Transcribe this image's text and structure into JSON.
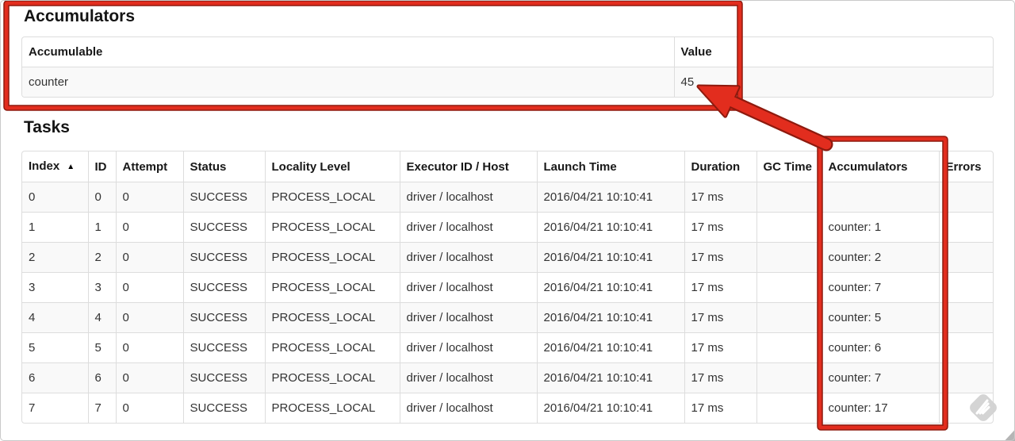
{
  "accumulators_section": {
    "heading": "Accumulators",
    "table": {
      "headers": [
        "Accumulable",
        "Value"
      ],
      "row": [
        "counter",
        "45"
      ]
    }
  },
  "tasks_section": {
    "heading": "Tasks",
    "sort_arrow": "▲",
    "table": {
      "headers": [
        "Index",
        "ID",
        "Attempt",
        "Status",
        "Locality Level",
        "Executor ID / Host",
        "Launch Time",
        "Duration",
        "GC Time",
        "Accumulators",
        "Errors"
      ],
      "rows": [
        [
          "0",
          "0",
          "0",
          "SUCCESS",
          "PROCESS_LOCAL",
          "driver / localhost",
          "2016/04/21 10:10:41",
          "17 ms",
          "",
          "",
          ""
        ],
        [
          "1",
          "1",
          "0",
          "SUCCESS",
          "PROCESS_LOCAL",
          "driver / localhost",
          "2016/04/21 10:10:41",
          "17 ms",
          "",
          "counter: 1",
          ""
        ],
        [
          "2",
          "2",
          "0",
          "SUCCESS",
          "PROCESS_LOCAL",
          "driver / localhost",
          "2016/04/21 10:10:41",
          "17 ms",
          "",
          "counter: 2",
          ""
        ],
        [
          "3",
          "3",
          "0",
          "SUCCESS",
          "PROCESS_LOCAL",
          "driver / localhost",
          "2016/04/21 10:10:41",
          "17 ms",
          "",
          "counter: 7",
          ""
        ],
        [
          "4",
          "4",
          "0",
          "SUCCESS",
          "PROCESS_LOCAL",
          "driver / localhost",
          "2016/04/21 10:10:41",
          "17 ms",
          "",
          "counter: 5",
          ""
        ],
        [
          "5",
          "5",
          "0",
          "SUCCESS",
          "PROCESS_LOCAL",
          "driver / localhost",
          "2016/04/21 10:10:41",
          "17 ms",
          "",
          "counter: 6",
          ""
        ],
        [
          "6",
          "6",
          "0",
          "SUCCESS",
          "PROCESS_LOCAL",
          "driver / localhost",
          "2016/04/21 10:10:41",
          "17 ms",
          "",
          "counter: 7",
          ""
        ],
        [
          "7",
          "7",
          "0",
          "SUCCESS",
          "PROCESS_LOCAL",
          "driver / localhost",
          "2016/04/21 10:10:41",
          "17 ms",
          "",
          "counter: 17",
          ""
        ]
      ]
    }
  },
  "annotations": {
    "red_color": "#e22d1e",
    "outline_color": "#8e1a0e"
  },
  "watermark": {
    "name": "skitch-pencil-watermark",
    "color": "#d2d2d2",
    "handle_color": "#b5b5b5"
  }
}
